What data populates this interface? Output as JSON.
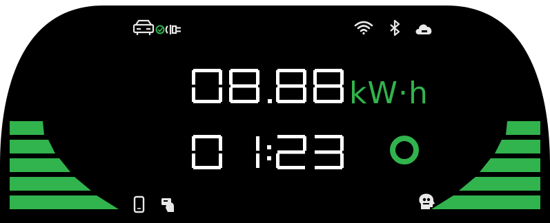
{
  "display": {
    "energy_value": "08.88",
    "energy_unit": "kW·h",
    "time_value": "01:23"
  },
  "status_icons": {
    "left": [
      "car-icon",
      "check-icon",
      "plug-icon"
    ],
    "right": [
      "wifi-icon",
      "bluetooth-icon",
      "cloud-icon"
    ]
  },
  "bottom_icons": {
    "left": [
      "phone-icon",
      "card-tap-icon"
    ],
    "right": [
      "face-id-icon"
    ]
  },
  "charge_level": {
    "left_bars_lit": 5,
    "right_bars_lit": 5
  },
  "colors": {
    "background": "#000000",
    "digits": "#ffffff",
    "accent": "#31b34d",
    "icon_gray": "#e8e8e8"
  }
}
